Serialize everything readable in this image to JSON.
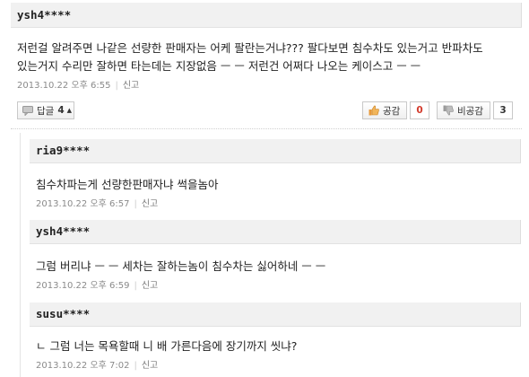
{
  "main_comment": {
    "username": "ysh4****",
    "text_line1": "저런걸 알려주면 나같은 선량한 판매자는 어케 팔란는거냐??? 팔다보면 침수차도 있는거고 반파차도",
    "text_line2": "있는거지 수리만 잘하면 타는데는 지장없음 ㅡ ㅡ 저런건 어쩌다 나오는 케이스고 ㅡ ㅡ",
    "date": "2013.10.22 오후 6:55",
    "report": "신고"
  },
  "actions": {
    "reply_label": "답글",
    "reply_count": "4",
    "like_label": "공감",
    "like_count": "0",
    "dislike_label": "비공감",
    "dislike_count": "3"
  },
  "replies": [
    {
      "username": "ria9****",
      "text": "침수차파는게 선량한판매자냐 썩을놈아",
      "date": "2013.10.22 오후 6:57",
      "report": "신고"
    },
    {
      "username": "ysh4****",
      "text": "그럼 버리냐 ㅡ ㅡ 세차는 잘하는놈이 침수차는 싫어하네 ㅡ ㅡ",
      "date": "2013.10.22 오후 6:59",
      "report": "신고"
    },
    {
      "username": "susu****",
      "text": "ㄴ 그럼 너는 목욕할때 니 배 가른다음에 장기까지 씻냐?",
      "date": "2013.10.22 오후 7:02",
      "report": "신고"
    }
  ],
  "colors": {
    "like_count": "#d33b2c",
    "dislike_count": "#333333",
    "user_bar": "#f1f1f1"
  }
}
